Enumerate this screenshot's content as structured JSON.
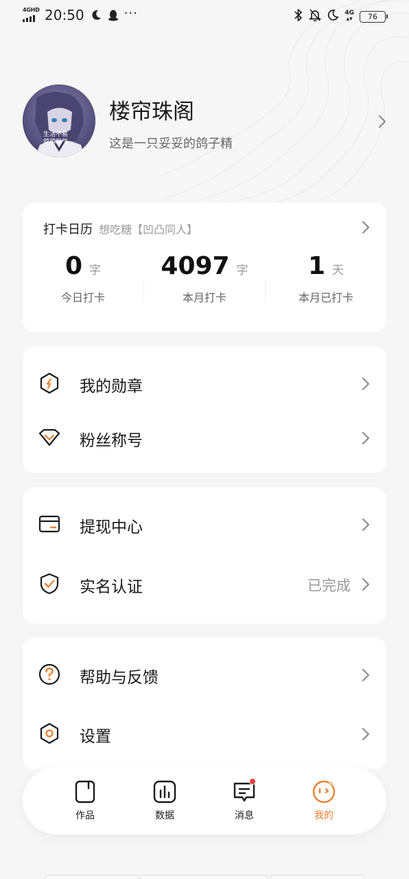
{
  "status_bar": {
    "network": "4GHD",
    "time": "20:50",
    "more": "···",
    "right_network": "4G",
    "battery": "76"
  },
  "profile": {
    "name": "楼帘珠阁",
    "bio": "这是一只妥妥的鸽子精",
    "avatar_caption_line1": "生活不易",
    "avatar_caption_line2": "鸽鸽叹气"
  },
  "checkin": {
    "title": "打卡日历",
    "subtitle": "想吃糖【凹凸同人】",
    "stats": [
      {
        "value": "0",
        "unit": "字",
        "label": "今日打卡"
      },
      {
        "value": "4097",
        "unit": "字",
        "label": "本月打卡"
      },
      {
        "value": "1",
        "unit": "天",
        "label": "本月已打卡"
      }
    ]
  },
  "menu": {
    "medals": {
      "label": "我的勋章",
      "icon": "medal-icon"
    },
    "fan_title": {
      "label": "粉丝称号",
      "icon": "diamond-icon"
    },
    "withdraw": {
      "label": "提现中心",
      "icon": "wallet-icon"
    },
    "verify": {
      "label": "实名认证",
      "status": "已完成",
      "icon": "shield-check-icon"
    },
    "help": {
      "label": "帮助与反馈",
      "icon": "question-icon"
    },
    "settings": {
      "label": "设置",
      "icon": "settings-hexagon-icon"
    }
  },
  "tabs": [
    {
      "label": "作品",
      "icon": "document-icon"
    },
    {
      "label": "数据",
      "icon": "bar-chart-icon"
    },
    {
      "label": "消息",
      "icon": "message-icon"
    },
    {
      "label": "我的",
      "icon": "face-icon"
    }
  ],
  "colors": {
    "accent": "#e8822f",
    "background": "#f6f6f6",
    "badge": "#e8403a"
  }
}
